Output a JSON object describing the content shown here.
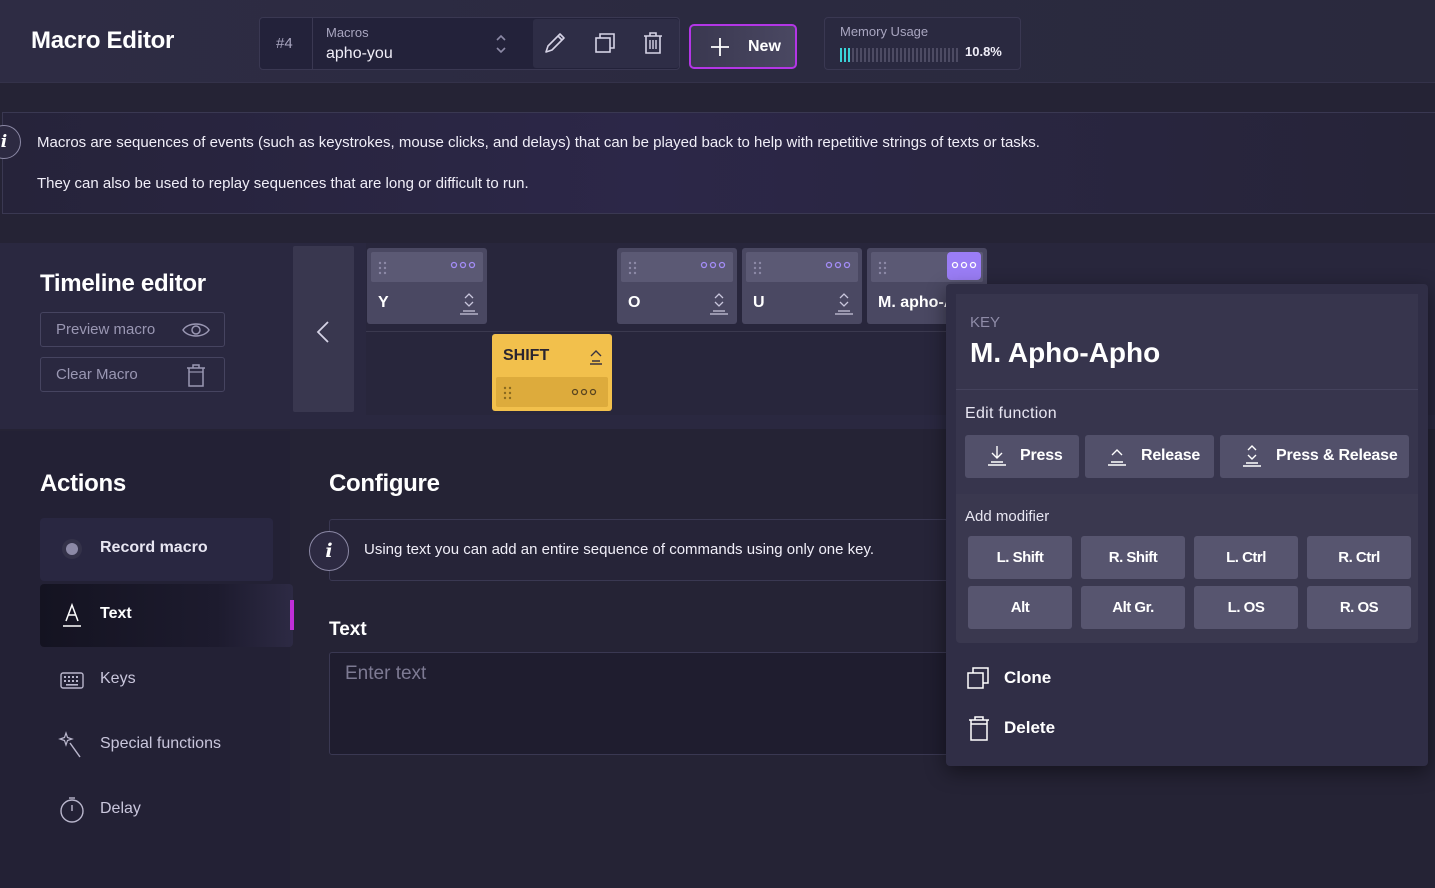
{
  "header": {
    "title": "Macro Editor",
    "macro_number": "#4",
    "macro_caption": "Macros",
    "macro_name": "apho-you",
    "new_label": "New",
    "memory_caption": "Memory Usage",
    "memory_percent": "10.8%",
    "memory_fraction": 0.108
  },
  "info": {
    "icon_letter": "i",
    "line1": "Macros are sequences of events (such as keystrokes, mouse clicks, and delays) that can be played back to help with repetitive strings of texts or tasks.",
    "line2": "They can also be used to replay sequences that are long or difficult to run."
  },
  "timeline": {
    "title": "Timeline editor",
    "preview_label": "Preview macro",
    "clear_label": "Clear Macro",
    "keys": [
      {
        "label": "Y"
      },
      {
        "label": "O"
      },
      {
        "label": "U"
      },
      {
        "label": "M. apho-Apho"
      }
    ],
    "modifier_card": {
      "label": "SHIFT"
    }
  },
  "actions": {
    "title": "Actions",
    "items": [
      {
        "label": "Record macro",
        "icon": "record-dot-icon"
      },
      {
        "label": "Text",
        "icon": "text-icon"
      },
      {
        "label": "Keys",
        "icon": "keyboard-icon"
      },
      {
        "label": "Special functions",
        "icon": "magic-wand-icon"
      },
      {
        "label": "Delay",
        "icon": "timer-icon"
      }
    ]
  },
  "configure": {
    "title": "Configure",
    "info_text": "Using text you can add an entire sequence of commands using only one key.",
    "text_label": "Text",
    "text_placeholder": "Enter text",
    "text_value": ""
  },
  "popover": {
    "kind": "KEY",
    "name": "M. Apho-Apho",
    "edit_function_title": "Edit function",
    "functions": [
      "Press",
      "Release",
      "Press & Release"
    ],
    "add_modifier_title": "Add modifier",
    "modifiers": [
      "L. Shift",
      "R. Shift",
      "L. Ctrl",
      "R. Ctrl",
      "Alt",
      "Alt Gr.",
      "L. OS",
      "R. OS"
    ],
    "clone_label": "Clone",
    "delete_label": "Delete"
  },
  "colors": {
    "accent_purple": "#b336e6",
    "memory_bar": "#3ad2d8",
    "shift_card": "#f2c04c",
    "active_dots": "#9a7df5"
  }
}
